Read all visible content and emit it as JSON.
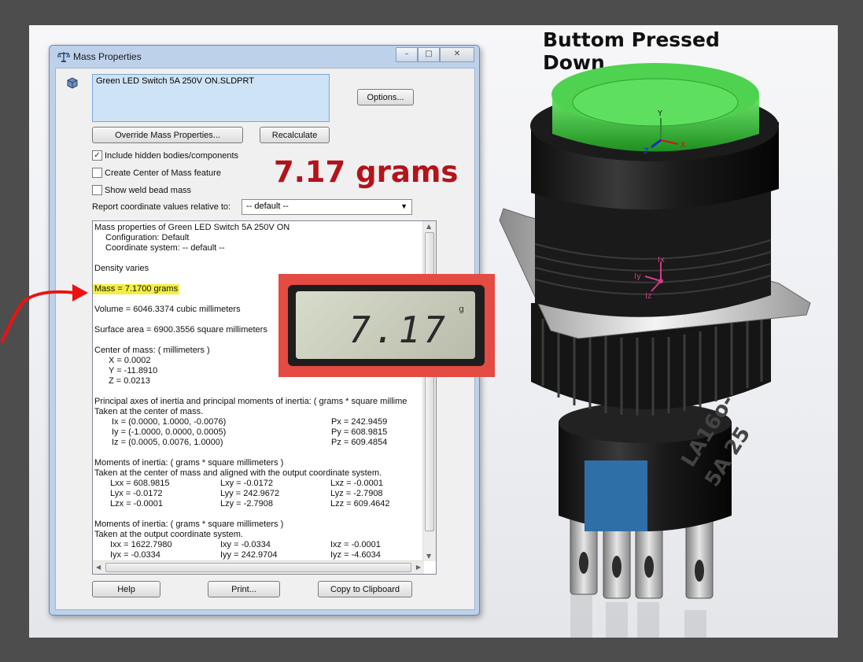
{
  "heading": "Buttom Pressed Down",
  "big_mass_label": "7.17 grams",
  "scale": {
    "reading": "7.17",
    "unit": "g"
  },
  "dialog": {
    "title": "Mass Properties",
    "title_buttons": [
      "–",
      "□",
      "✕"
    ],
    "file_name": "Green LED Switch 5A 250V ON.SLDPRT",
    "options_label": "Options...",
    "override_label": "Override Mass Properties...",
    "recalculate_label": "Recalculate",
    "checkboxes": [
      {
        "label": "Include hidden bodies/components",
        "checked": true
      },
      {
        "label": "Create Center of Mass feature",
        "checked": false
      },
      {
        "label": "Show weld bead mass",
        "checked": false
      }
    ],
    "report_label": "Report coordinate values relative to:",
    "report_value": "-- default --",
    "results": {
      "title": "Mass properties of Green LED Switch 5A 250V ON",
      "configuration": "Configuration: Default",
      "coordinate_system": "Coordinate system: -- default --",
      "density": "Density varies",
      "mass": "Mass = 7.1700 grams",
      "volume": "Volume = 6046.3374 cubic millimeters",
      "surface_area": "Surface area = 6900.3556  square millimeters",
      "com_header": "Center of mass: ( millimeters )",
      "com": [
        "X = 0.0002",
        "Y = -11.8910",
        "Z = 0.0213"
      ],
      "principal_header": "Principal axes of inertia and principal moments of inertia: ( grams *  square millime",
      "principal_sub": "Taken at the center of mass.",
      "principal_rows": [
        [
          "Ix = (0.0000,  1.0000, -0.0076)",
          "Px = 242.9459"
        ],
        [
          "Iy = (-1.0000,  0.0000,  0.0005)",
          "Py = 608.9815"
        ],
        [
          "Iz = (0.0005,  0.0076,  1.0000)",
          "Pz = 609.4854"
        ]
      ],
      "moi1_header": "Moments of inertia: ( grams *  square millimeters )",
      "moi1_sub": "Taken at the center of mass and aligned with the output coordinate system.",
      "moi1_rows": [
        [
          "Lxx = 608.9815",
          "Lxy = -0.0172",
          "Lxz = -0.0001"
        ],
        [
          "Lyx = -0.0172",
          "Lyy = 242.9672",
          "Lyz = -2.7908"
        ],
        [
          "Lzx = -0.0001",
          "Lzy = -2.7908",
          "Lzz = 609.4642"
        ]
      ],
      "moi2_header": "Moments of inertia: ( grams *  square millimeters )",
      "moi2_sub": "Taken at the output coordinate system.",
      "moi2_rows": [
        [
          "Ixx = 1622.7980",
          "Ixy = -0.0334",
          "Ixz = -0.0001"
        ],
        [
          "Iyx = -0.0334",
          "Iyy = 242.9704",
          "Iyz = -4.6034"
        ]
      ]
    },
    "help_label": "Help",
    "print_label": "Print...",
    "copy_label": "Copy to Clipboard"
  },
  "switch_model": {
    "axis_labels": [
      "Y",
      "X",
      "Z",
      "Ix",
      "Iy",
      "Iz"
    ],
    "body_text": [
      "LA16o-",
      "5A 25"
    ]
  },
  "colors": {
    "accent_red": "#b3131b",
    "highlight": "#f3ef42",
    "scale_frame": "#e34b43",
    "led_green": "#3fbf3f"
  }
}
